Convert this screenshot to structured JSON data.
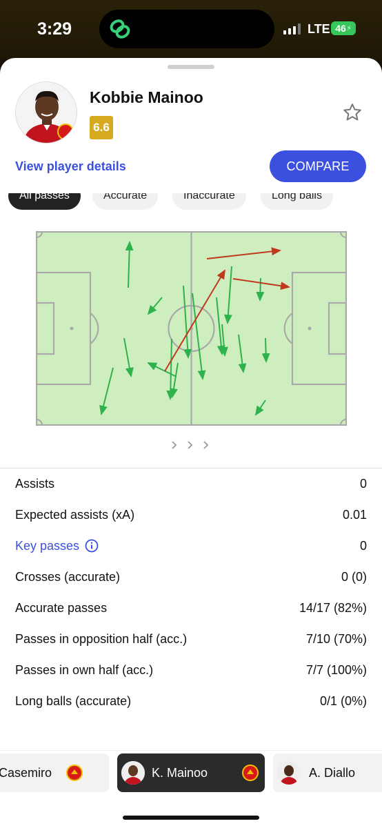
{
  "status": {
    "time": "3:29",
    "network": "LTE",
    "battery": "46"
  },
  "player": {
    "name": "Kobbie Mainoo",
    "rating": "6.6"
  },
  "actions": {
    "view_details": "View player details",
    "compare": "COMPARE"
  },
  "filters": [
    "All passes",
    "Accurate",
    "Inaccurate",
    "Long balls"
  ],
  "colors": {
    "accent": "#3b50de",
    "rating": "#d7ab1f",
    "pitch": "#cfeec0",
    "pass_ok": "#2fb24c",
    "pass_bad": "#c0391f"
  },
  "pager": "> > >",
  "stats": [
    {
      "label": "Assists",
      "value": "0"
    },
    {
      "label": "Expected assists (xA)",
      "value": "0.01"
    },
    {
      "label": "Key passes",
      "value": "0",
      "link": true
    },
    {
      "label": "Crosses (accurate)",
      "value": "0 (0)"
    },
    {
      "label": "Accurate passes",
      "value": "14/17 (82%)"
    },
    {
      "label": "Passes in opposition half (acc.)",
      "value": "7/10 (70%)"
    },
    {
      "label": "Passes in own half (acc.)",
      "value": "7/7 (100%)"
    },
    {
      "label": "Long balls (accurate)",
      "value": "0/1 (0%)"
    }
  ],
  "bottom_players": [
    {
      "name": "Casemiro"
    },
    {
      "name": "K. Mainoo"
    },
    {
      "name": "A. Diallo"
    }
  ]
}
